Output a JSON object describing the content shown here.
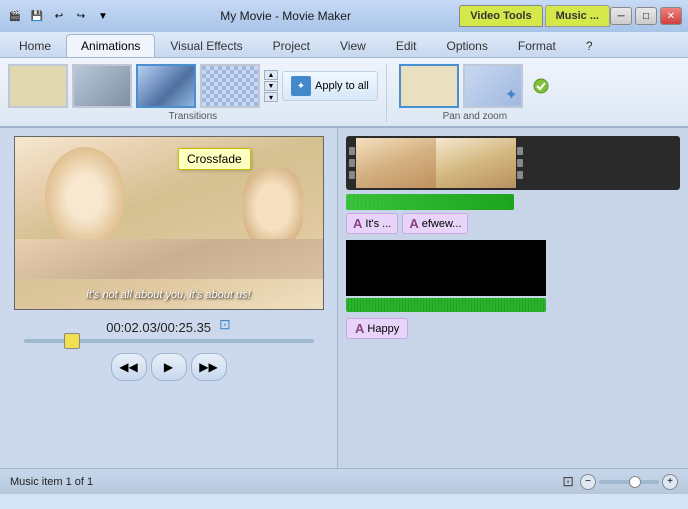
{
  "titlebar": {
    "title": "My Movie - Movie Maker",
    "tabs": [
      {
        "label": "Video Tools",
        "class": "video"
      },
      {
        "label": "Music ...",
        "class": "music"
      }
    ],
    "controls": [
      "─",
      "□",
      "✕"
    ]
  },
  "quickaccess": {
    "buttons": [
      "💾",
      "↩",
      "↪",
      "▼"
    ]
  },
  "ribbon": {
    "tabs": [
      "Home",
      "Animations",
      "Visual Effects",
      "Project",
      "View",
      "Edit",
      "Options",
      "Format",
      "?"
    ],
    "active_tab": "Animations",
    "transitions": {
      "label": "Transitions",
      "items": [
        "blank",
        "gray",
        "crossfade",
        "checker"
      ],
      "apply_label": "Apply to all",
      "tooltip": "Crossfade"
    },
    "panzoom": {
      "label": "Pan and zoom",
      "items": [
        "blank",
        "zoom"
      ]
    }
  },
  "preview": {
    "timecode": "00:02.03/00:25.35",
    "overlay_text": "it's not all about you, it's about us!",
    "transport": {
      "prev": "◀◀",
      "play": "▶",
      "next": "▶▶"
    }
  },
  "timeline": {
    "caption_items": [
      {
        "label": "It's ...",
        "prefix": "A"
      },
      {
        "label": "efwew...",
        "prefix": "A"
      }
    ],
    "happy": {
      "label": "Happy",
      "prefix": "A"
    }
  },
  "statusbar": {
    "text": "Music item 1 of 1",
    "zoom_minus": "−",
    "zoom_plus": "+"
  }
}
